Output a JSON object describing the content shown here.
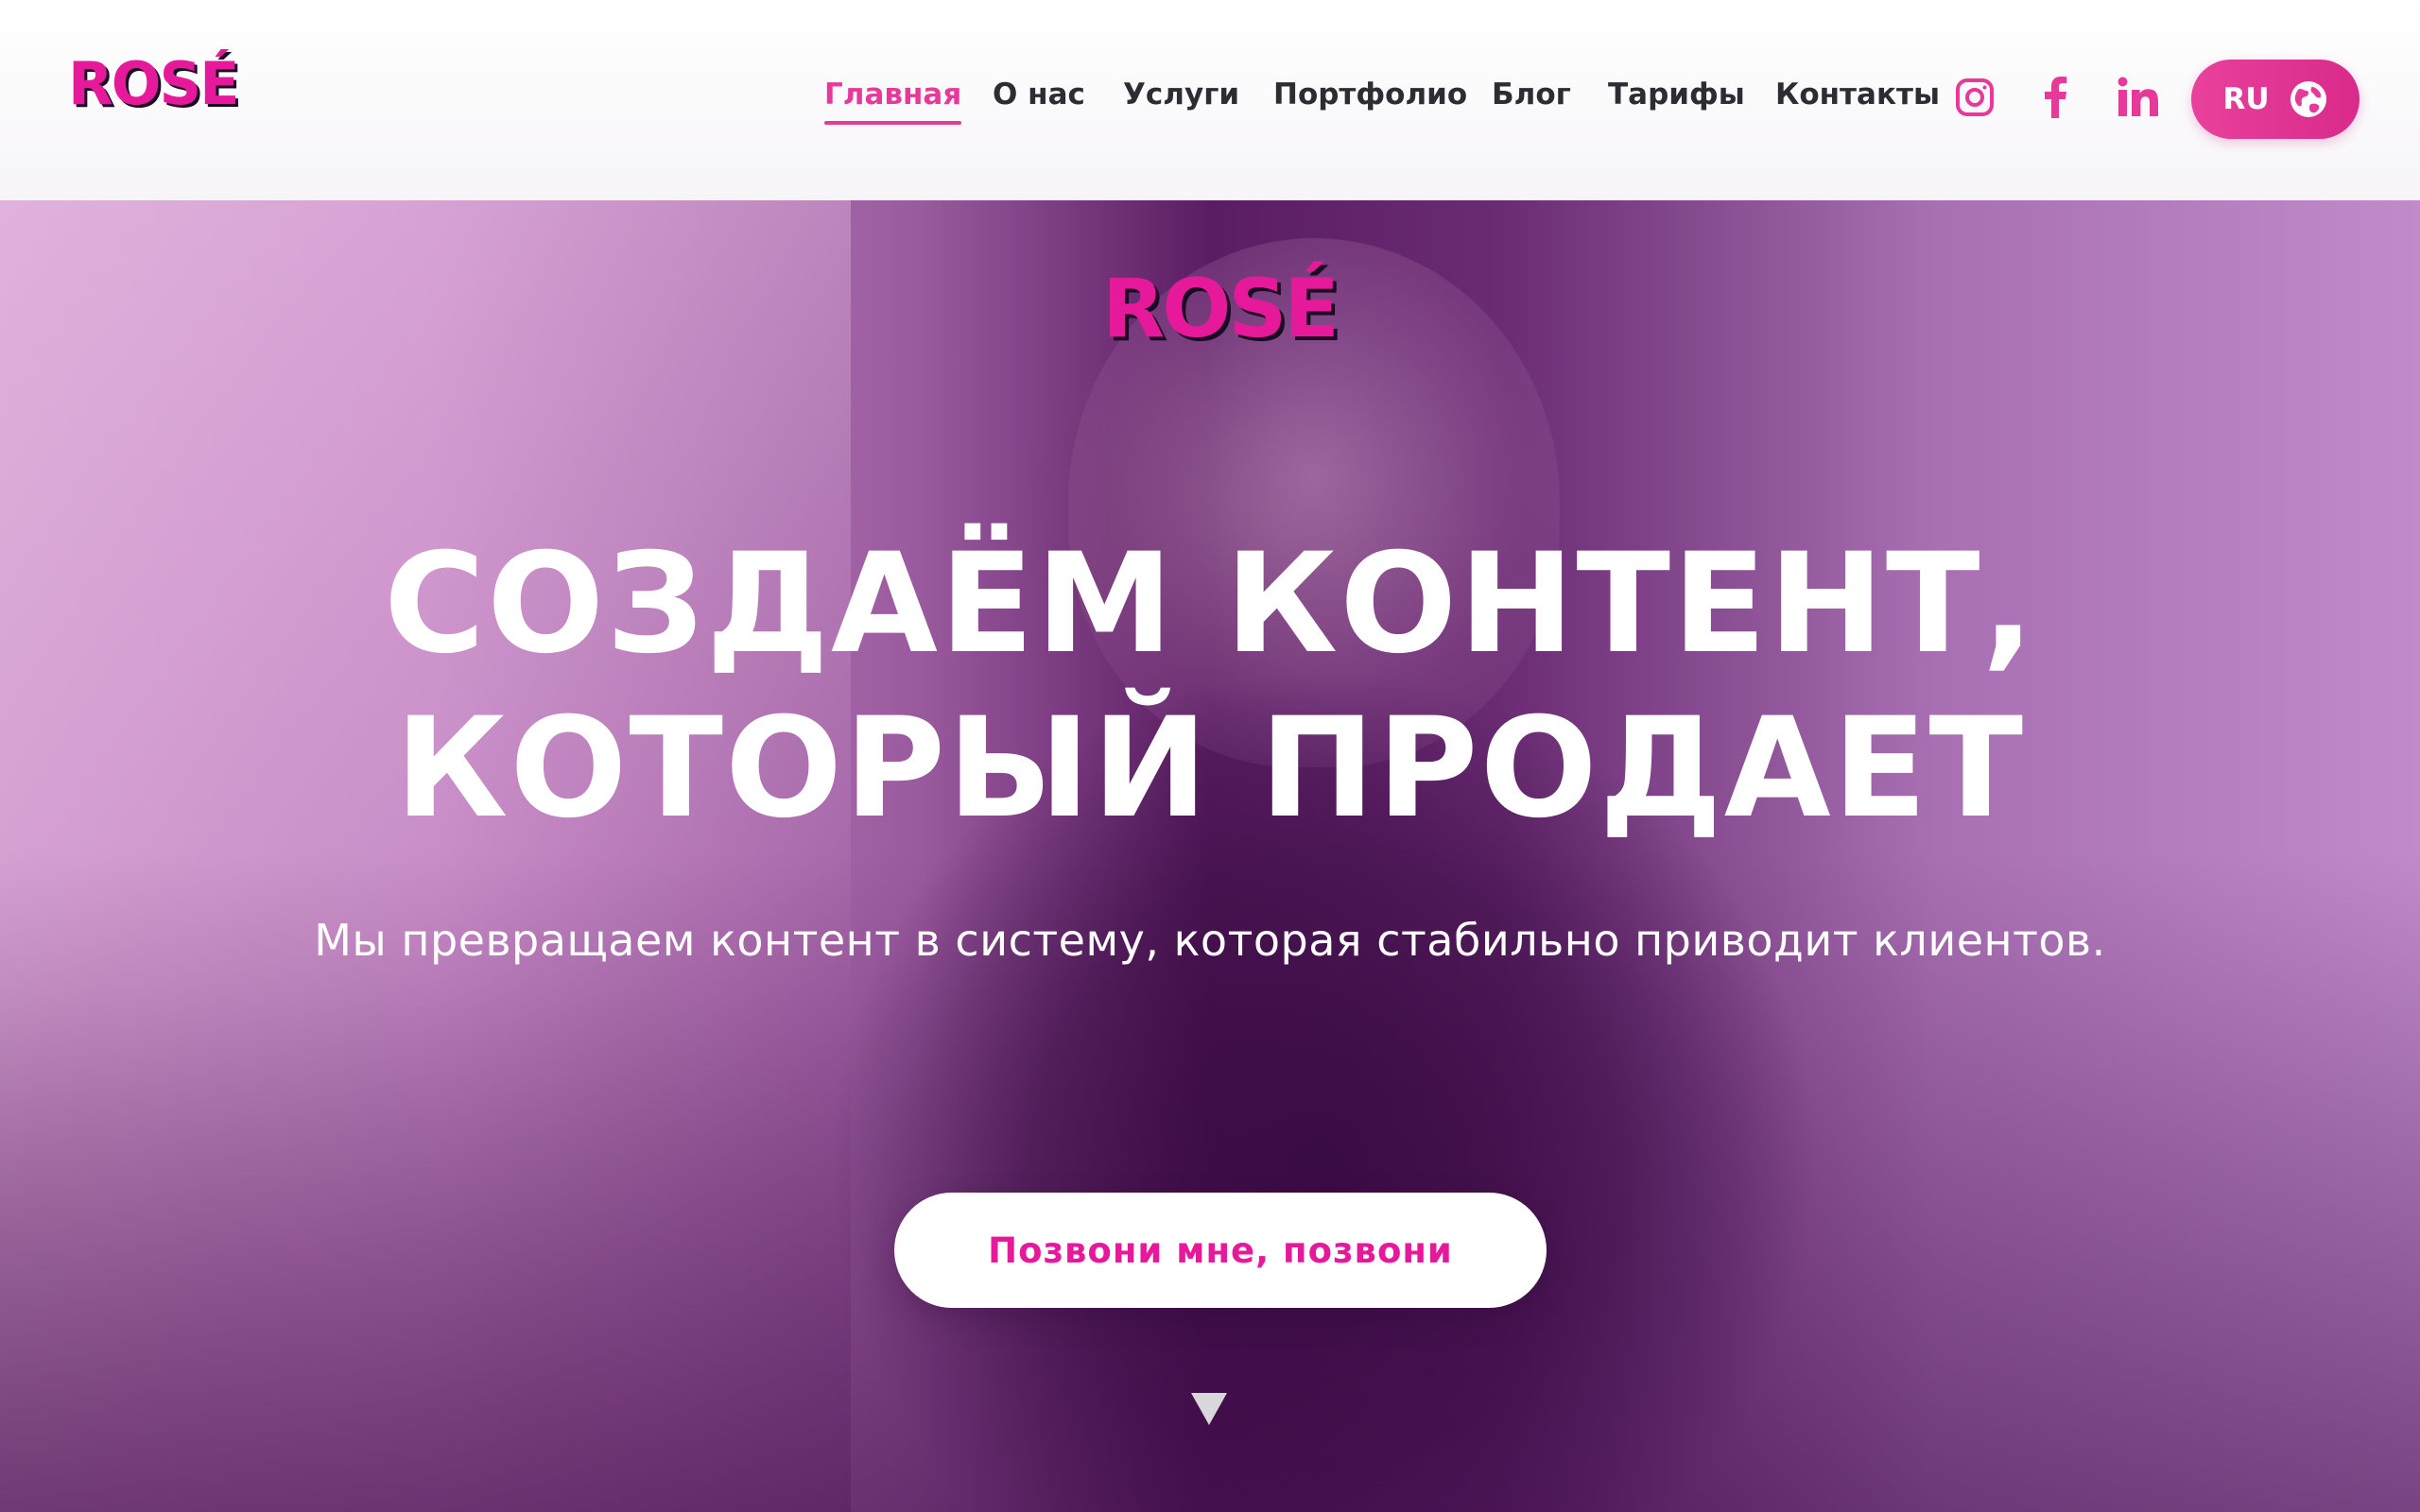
{
  "header": {
    "logo_text": "ROSÉ",
    "nav": [
      {
        "label": "Главная",
        "active": true
      },
      {
        "label": "О нас",
        "active": false
      },
      {
        "label": "Услуги",
        "active": false
      },
      {
        "label": "Портфолио",
        "active": false
      },
      {
        "label": "Блог",
        "active": false
      },
      {
        "label": "Тарифы",
        "active": false
      },
      {
        "label": "Контакты",
        "active": false
      }
    ],
    "social": [
      {
        "icon": "instagram-icon"
      },
      {
        "icon": "facebook-icon"
      },
      {
        "icon": "linkedin-icon"
      }
    ],
    "language": {
      "label": "RU",
      "icon": "globe-icon"
    }
  },
  "hero": {
    "logo_text": "ROSÉ",
    "title_line_1": "СОЗДАЁМ КОНТЕНТ,",
    "title_line_2": "КОТОРЫЙ ПРОДАЕТ",
    "subtitle": "Мы превращаем контент в систему, которая стабильно приводит клиентов.",
    "cta_label": "Позвони мне, позвони",
    "scroll_icon": "triangle-down-icon"
  },
  "colors": {
    "accent": "#e6399a",
    "brand_pink": "#e6199a",
    "nav_text": "#2c2c33",
    "hero_purple": "#5a1c62"
  }
}
